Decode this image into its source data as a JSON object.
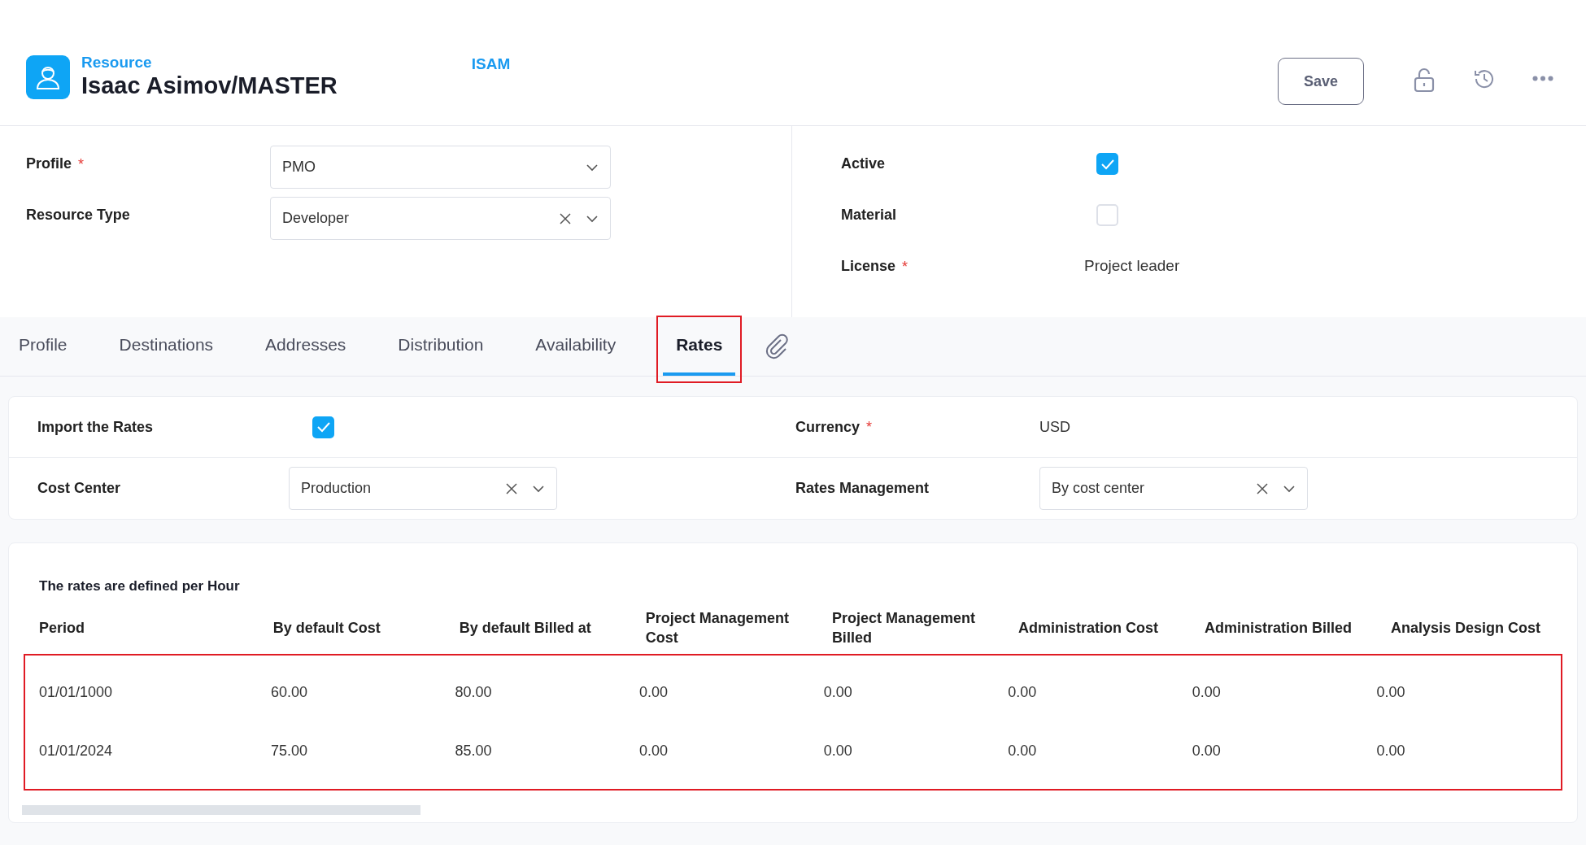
{
  "header": {
    "kind_label": "Resource",
    "title": "Isaac Asimov/MASTER",
    "code": "ISAM",
    "save_button": "Save"
  },
  "form_left": [
    {
      "label": "Profile",
      "required_mark": "*",
      "value": "PMO",
      "clearable": false
    },
    {
      "label": "Resource Type",
      "value": "Developer",
      "clearable": true
    }
  ],
  "form_right": [
    {
      "kind": "checkbox",
      "label": "Active",
      "checked": true
    },
    {
      "kind": "checkbox",
      "label": "Material",
      "checked": false
    },
    {
      "kind": "text",
      "label": "License",
      "required_mark": "*",
      "value": "Project leader"
    }
  ],
  "tabs": [
    {
      "label": "Profile",
      "selected": false
    },
    {
      "label": "Destinations",
      "selected": false
    },
    {
      "label": "Addresses",
      "selected": false
    },
    {
      "label": "Distribution",
      "selected": false
    },
    {
      "label": "Availability",
      "selected": false
    },
    {
      "label": "Rates",
      "selected": true
    }
  ],
  "rates_settings": [
    [
      {
        "kind": "checkbox",
        "label": "Import the Rates",
        "checked": true
      },
      {
        "kind": "text",
        "label": "Currency",
        "required_mark": "*",
        "value": "USD"
      }
    ],
    [
      {
        "kind": "select",
        "label": "Cost Center",
        "value": "Production",
        "clearable": true
      },
      {
        "kind": "select",
        "label": "Rates Management",
        "value": "By cost center",
        "clearable": true
      }
    ]
  ],
  "rates_table": {
    "caption": "The rates are defined per Hour",
    "columns": [
      "Period",
      "By default Cost",
      "By default Billed at",
      "Project Management Cost",
      "Project Management Billed",
      "Administration Cost",
      "Administration Billed",
      "Analysis Design Cost"
    ],
    "rows": [
      [
        "01/01/1000",
        "60.00",
        "80.00",
        "0.00",
        "0.00",
        "0.00",
        "0.00",
        "0.00"
      ],
      [
        "01/01/2024",
        "75.00",
        "85.00",
        "0.00",
        "0.00",
        "0.00",
        "0.00",
        "0.00"
      ]
    ]
  }
}
